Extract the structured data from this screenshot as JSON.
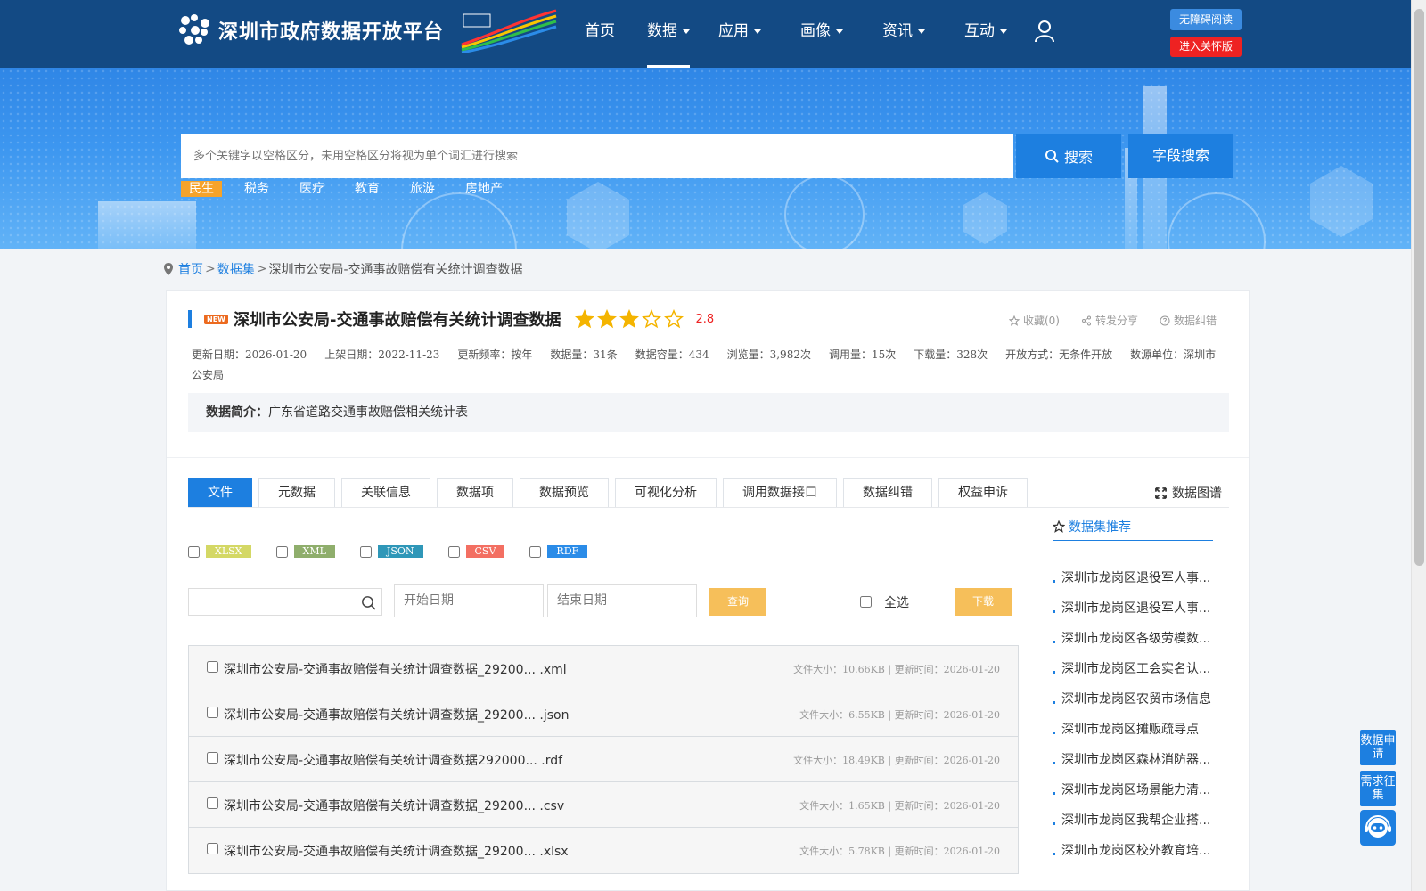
{
  "header": {
    "site_title": "深圳市政府数据开放平台",
    "nav": [
      {
        "label": "首页",
        "dropdown": false,
        "active": false
      },
      {
        "label": "数据",
        "dropdown": true,
        "active": true
      },
      {
        "label": "应用",
        "dropdown": true,
        "active": false
      },
      {
        "label": "画像",
        "dropdown": true,
        "active": false
      },
      {
        "label": "资讯",
        "dropdown": true,
        "active": false
      },
      {
        "label": "互动",
        "dropdown": true,
        "active": false
      }
    ],
    "accessible_btn": "无障碍阅读",
    "care_btn": "进入关怀版"
  },
  "search": {
    "placeholder": "多个关键字以空格区分，未用空格区分将视为单个词汇进行搜索",
    "search_btn": "搜索",
    "field_search_btn": "字段搜索",
    "tags": [
      {
        "label": "民生",
        "active": true
      },
      {
        "label": "税务",
        "active": false
      },
      {
        "label": "医疗",
        "active": false
      },
      {
        "label": "教育",
        "active": false
      },
      {
        "label": "旅游",
        "active": false
      },
      {
        "label": "房地产",
        "active": false
      }
    ]
  },
  "breadcrumb": {
    "home": "首页",
    "datasets": "数据集",
    "current": "深圳市公安局-交通事故赔偿有关统计调查数据"
  },
  "dataset": {
    "new_badge": "NEW",
    "title": "深圳市公安局-交通事故赔偿有关统计调查数据",
    "rating": 2.8,
    "score_text": "2.8",
    "actions": {
      "favorite": "收藏(0)",
      "share": "转发分享",
      "report": "数据纠错"
    },
    "meta": [
      "更新日期：2026-01-20",
      "上架日期：2022-11-23",
      "更新频率：按年",
      "数据量：31条",
      "数据容量：434",
      "浏览量：3,982次",
      "调用量：15次",
      "下载量：328次",
      "开放方式：无条件开放",
      "数源单位：深圳市公安局"
    ],
    "intro_label": "数据简介：",
    "intro_text": "广东省道路交通事故赔偿相关统计表"
  },
  "tabs": [
    {
      "label": "文件",
      "active": true
    },
    {
      "label": "元数据",
      "active": false
    },
    {
      "label": "关联信息",
      "active": false
    },
    {
      "label": "数据项",
      "active": false
    },
    {
      "label": "数据预览",
      "active": false
    },
    {
      "label": "可视化分析",
      "active": false
    },
    {
      "label": "调用数据接口",
      "active": false
    },
    {
      "label": "数据纠错",
      "active": false
    },
    {
      "label": "权益申诉",
      "active": false
    }
  ],
  "graph_link": "数据图谱",
  "formats": [
    {
      "label": "XLSX",
      "color": "#d4d865"
    },
    {
      "label": "XML",
      "color": "#8fae6c"
    },
    {
      "label": "JSON",
      "color": "#2f97b8"
    },
    {
      "label": "CSV",
      "color": "#f36f62"
    },
    {
      "label": "RDF",
      "color": "#2b8ce8"
    }
  ],
  "filter": {
    "keyword_value": "",
    "start_date": "开始日期",
    "end_date": "结束日期",
    "query_btn": "查询",
    "select_all": "全选",
    "download_btn": "下载"
  },
  "files": [
    {
      "name": "深圳市公安局-交通事故赔偿有关统计调查数据_29200... .xml",
      "size": "文件大小：10.66KB",
      "updated": "更新时间：2026-01-20"
    },
    {
      "name": "深圳市公安局-交通事故赔偿有关统计调查数据_29200... .json",
      "size": "文件大小：6.55KB",
      "updated": "更新时间：2026-01-20"
    },
    {
      "name": "深圳市公安局-交通事故赔偿有关统计调查数据292000... .rdf",
      "size": "文件大小：18.49KB",
      "updated": "更新时间：2026-01-20"
    },
    {
      "name": "深圳市公安局-交通事故赔偿有关统计调查数据_29200... .csv",
      "size": "文件大小：1.65KB",
      "updated": "更新时间：2026-01-20"
    },
    {
      "name": "深圳市公安局-交通事故赔偿有关统计调查数据_29200... .xlsx",
      "size": "文件大小：5.78KB",
      "updated": "更新时间：2026-01-20"
    }
  ],
  "recommend": {
    "title": "数据集推荐",
    "items": [
      "深圳市龙岗区退役军人事...",
      "深圳市龙岗区退役军人事...",
      "深圳市龙岗区各级劳模数...",
      "深圳市龙岗区工会实名认...",
      "深圳市龙岗区农贸市场信息",
      "深圳市龙岗区摊贩疏导点",
      "深圳市龙岗区森林消防器...",
      "深圳市龙岗区场景能力清...",
      "深圳市龙岗区我帮企业搭...",
      "深圳市龙岗区校外教育培..."
    ]
  },
  "floating": {
    "data_apply": "数据申请",
    "demand": "需求征集"
  },
  "colors": {
    "header_bg": "#134a84",
    "primary": "#1d7fe0",
    "tag_active": "#f6a32a",
    "star": "#f4b400",
    "care": "#ee2222",
    "button_orange": "#f6bf5a"
  }
}
